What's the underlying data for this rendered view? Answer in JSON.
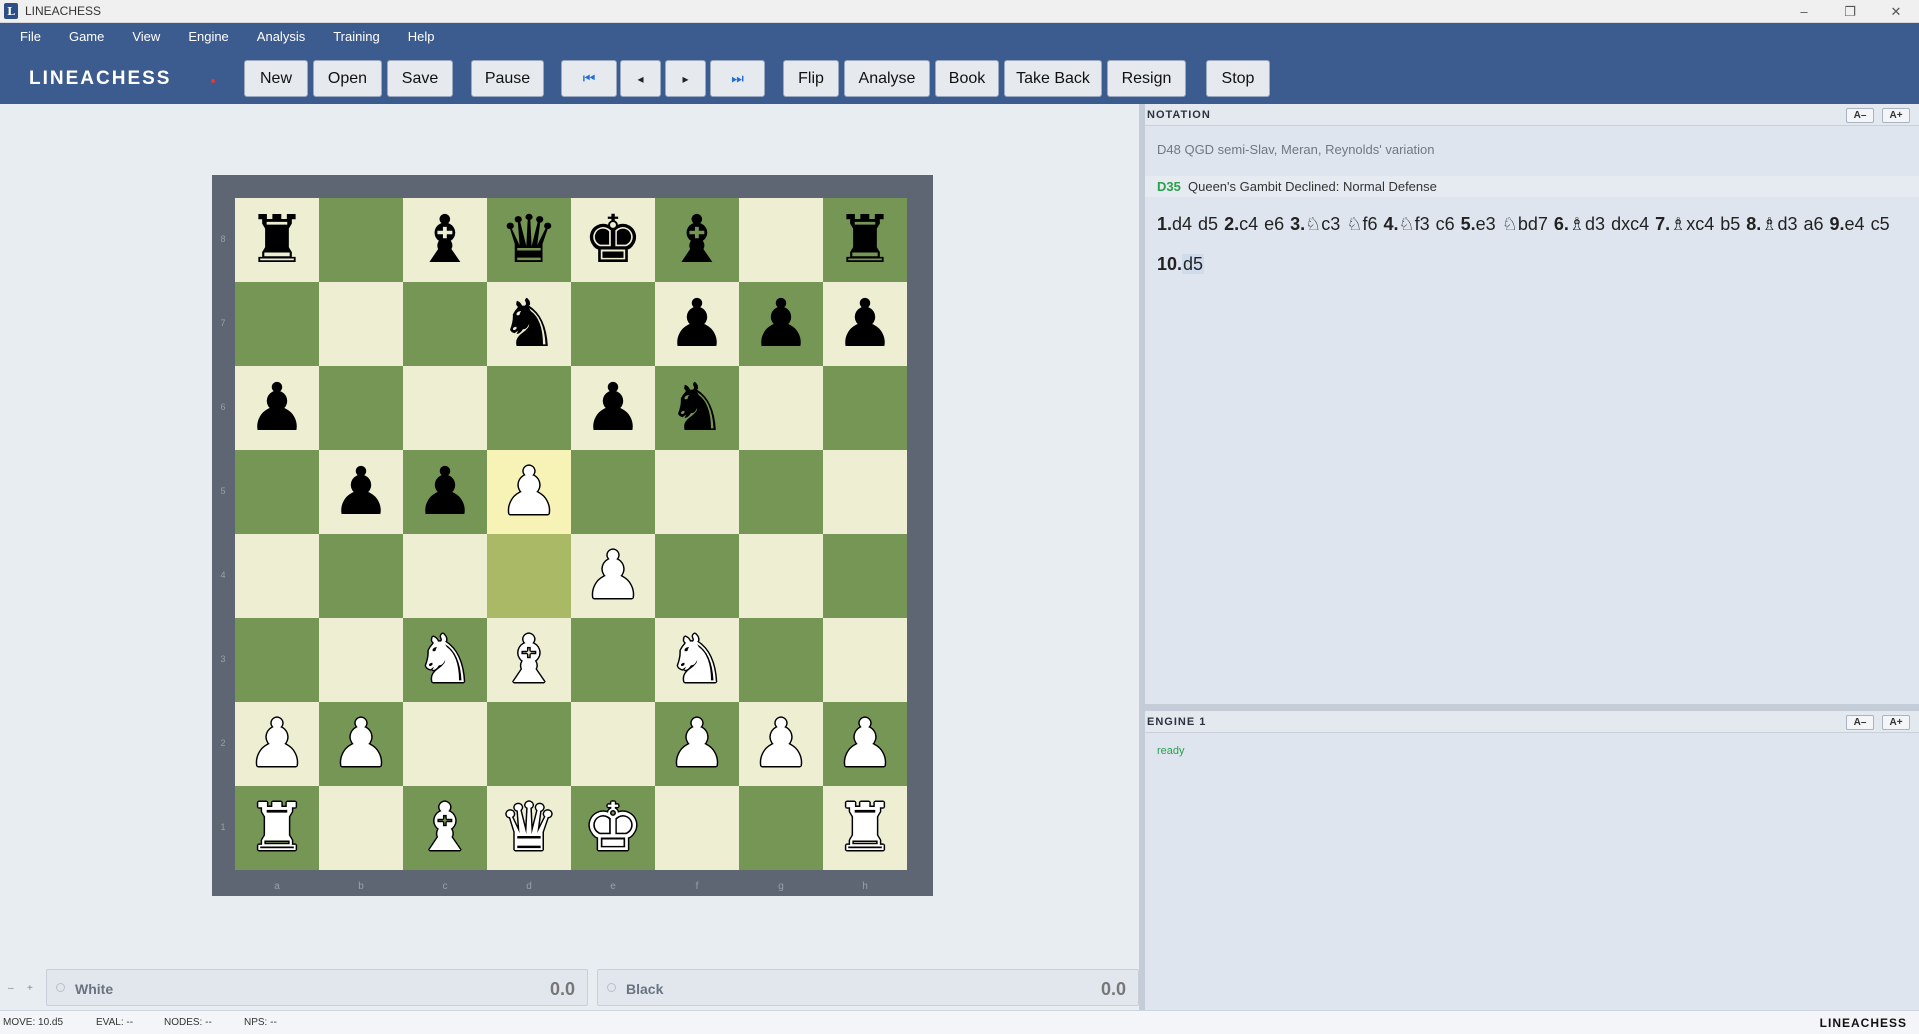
{
  "window": {
    "title": "LINEACHESS",
    "icon_letter": "L",
    "minimize": "–",
    "maximize": "❐",
    "close": "✕"
  },
  "menu": [
    "File",
    "Game",
    "View",
    "Engine",
    "Analysis",
    "Training",
    "Help"
  ],
  "brand": "LINEACHESS",
  "toolbar": {
    "new": "New",
    "open": "Open",
    "save": "Save",
    "pause": "Pause",
    "first": "⏮",
    "prev": "◂",
    "next": "▸",
    "last": "⏭",
    "flip": "Flip",
    "analyse": "Analyse",
    "book": "Book",
    "take_back": "Take Back",
    "resign": "Resign",
    "stop": "Stop"
  },
  "board": {
    "ranks": [
      "8",
      "7",
      "6",
      "5",
      "4",
      "3",
      "2",
      "1"
    ],
    "files": [
      "a",
      "b",
      "c",
      "d",
      "e",
      "f",
      "g",
      "h"
    ],
    "fen_rows": [
      "r.bqkb.r",
      "...n.ppp",
      "p...pn..",
      ".ppP....",
      "....P...",
      "..NB.N..",
      "PP...PPP",
      "R.BQK..R"
    ],
    "last_move": {
      "from": "d4",
      "to": "d5"
    }
  },
  "players": {
    "mini_minus": "–",
    "mini_plus": "+",
    "white": {
      "name": "White",
      "time": "0.0"
    },
    "black": {
      "name": "Black",
      "time": "0.0"
    }
  },
  "notation": {
    "title": "NOTATION",
    "font_minus": "A–",
    "font_plus": "A+",
    "opening": "D48 QGD semi-Slav, Meran, Reynolds' variation",
    "eco_code": "D35",
    "eco_name": "Queen's Gambit Declined: Normal Defense",
    "moves": [
      {
        "no": "1.",
        "white": "d4",
        "black": "d5"
      },
      {
        "no": "2.",
        "white": "c4",
        "black": "e6"
      },
      {
        "no": "3.",
        "white": "♘c3",
        "black": "♘f6"
      },
      {
        "no": "4.",
        "white": "♘f3",
        "black": "c6"
      },
      {
        "no": "5.",
        "white": "e3",
        "black": "♘bd7"
      },
      {
        "no": "6.",
        "white": "♗d3",
        "black": "dxc4"
      },
      {
        "no": "7.",
        "white": "♗xc4",
        "black": "b5"
      },
      {
        "no": "8.",
        "white": "♗d3",
        "black": "a6"
      },
      {
        "no": "9.",
        "white": "e4",
        "black": "c5"
      },
      {
        "no": "10.",
        "white": "d5",
        "black": ""
      }
    ]
  },
  "engine": {
    "title": "ENGINE 1",
    "font_minus": "A–",
    "font_plus": "A+",
    "status": "ready"
  },
  "status": {
    "move": "MOVE: 10.d5",
    "eval": "EVAL: --",
    "nodes": "NODES: --",
    "nps": "NPS: --",
    "brand": "LINEACHESS"
  }
}
